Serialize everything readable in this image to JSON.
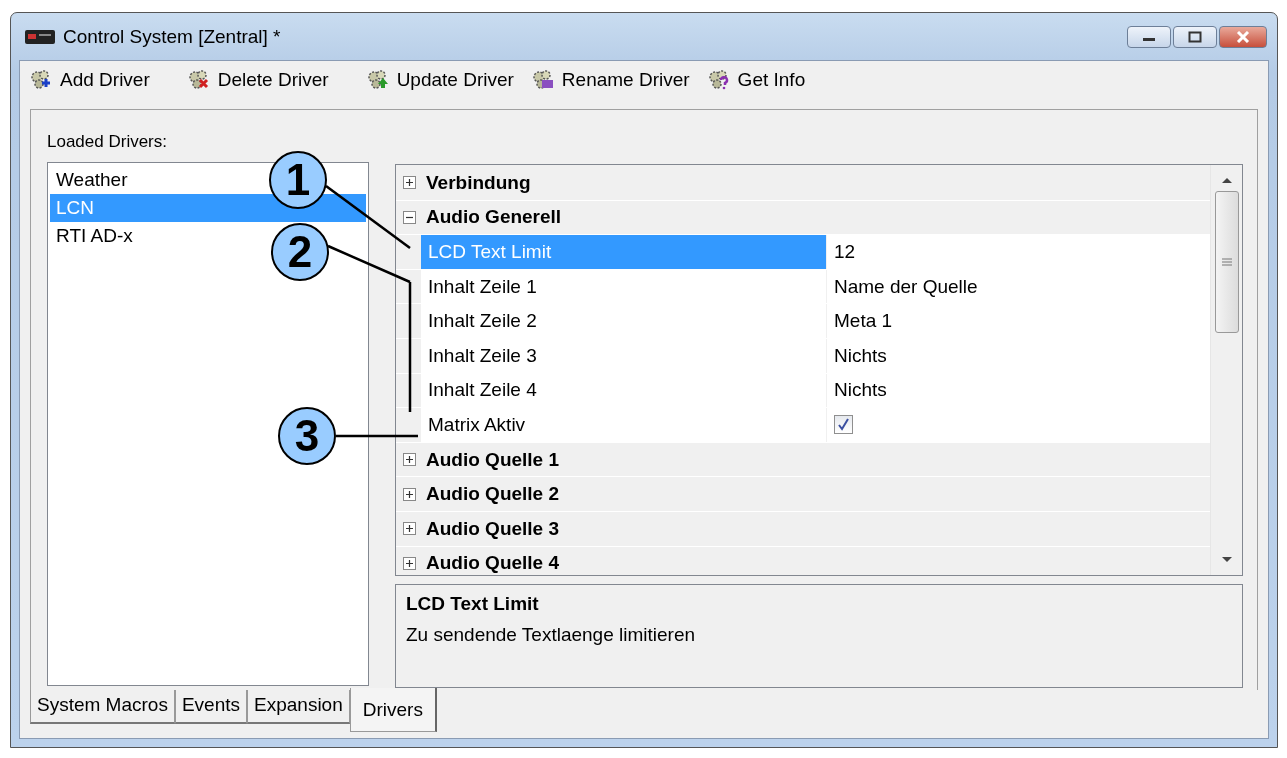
{
  "window": {
    "title": "Control System [Zentral] *"
  },
  "toolbar": [
    {
      "label": "Add Driver",
      "kind": "add"
    },
    {
      "label": "Delete Driver",
      "kind": "delete"
    },
    {
      "label": "Update Driver",
      "kind": "update"
    },
    {
      "label": "Rename Driver",
      "kind": "rename"
    },
    {
      "label": "Get Info",
      "kind": "info"
    }
  ],
  "loaded_drivers": {
    "label": "Loaded Drivers:",
    "items": [
      {
        "label": "Weather",
        "selected": false
      },
      {
        "label": "LCN",
        "selected": true
      },
      {
        "label": "RTI AD-x",
        "selected": false
      }
    ]
  },
  "property_grid": {
    "categories": [
      {
        "label": "Verbindung",
        "expanded": false
      },
      {
        "label": "Audio Generell",
        "expanded": true,
        "properties": [
          {
            "name": "LCD Text Limit",
            "kind": "text",
            "value": "12",
            "selected": true
          },
          {
            "name": "Inhalt Zeile 1",
            "kind": "text",
            "value": "Name der Quelle",
            "selected": false
          },
          {
            "name": "Inhalt Zeile 2",
            "kind": "text",
            "value": "Meta 1",
            "selected": false
          },
          {
            "name": "Inhalt Zeile 3",
            "kind": "text",
            "value": "Nichts",
            "selected": false
          },
          {
            "name": "Inhalt Zeile 4",
            "kind": "text",
            "value": "Nichts",
            "selected": false
          },
          {
            "name": "Matrix Aktiv",
            "kind": "checkbox",
            "checked": true,
            "selected": false
          }
        ]
      },
      {
        "label": "Audio Quelle 1",
        "expanded": false
      },
      {
        "label": "Audio Quelle 2",
        "expanded": false
      },
      {
        "label": "Audio Quelle 3",
        "expanded": false
      },
      {
        "label": "Audio Quelle 4",
        "expanded": false
      }
    ]
  },
  "description": {
    "title": "LCD Text Limit",
    "text": "Zu sendende Textlaenge limitieren"
  },
  "tabs": [
    {
      "label": "System Macros",
      "selected": false
    },
    {
      "label": "Events",
      "selected": false
    },
    {
      "label": "Expansion",
      "selected": false
    },
    {
      "label": "Drivers",
      "selected": true
    }
  ],
  "callouts": [
    {
      "label": "1"
    },
    {
      "label": "2"
    },
    {
      "label": "3"
    }
  ]
}
